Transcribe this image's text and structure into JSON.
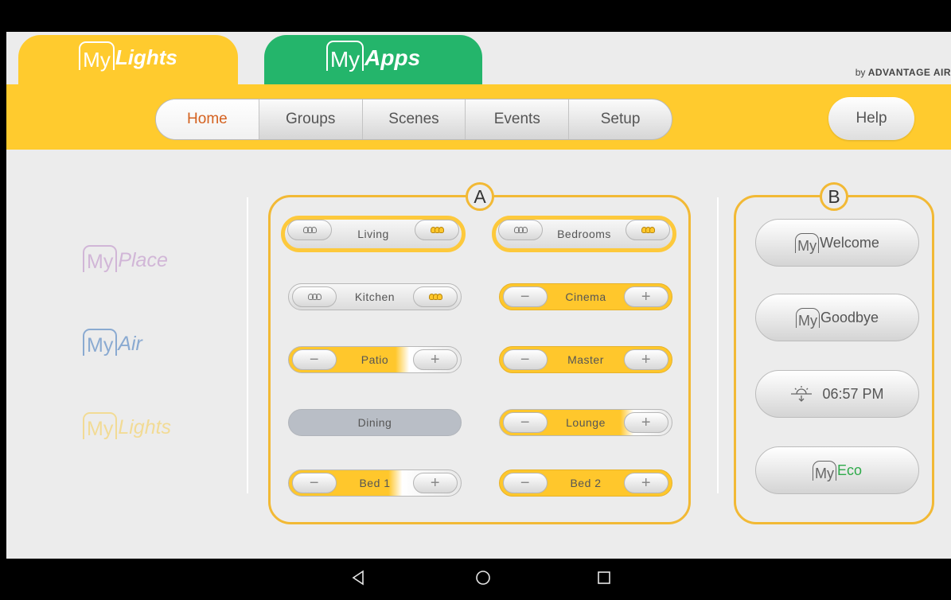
{
  "app_tabs": {
    "lights": {
      "prefix": "My",
      "name": "Lights"
    },
    "apps": {
      "prefix": "My",
      "name": "Apps"
    }
  },
  "branding": {
    "by": "by",
    "brand": "ADVANTAGE AIR"
  },
  "nav": {
    "items": [
      "Home",
      "Groups",
      "Scenes",
      "Events",
      "Setup"
    ],
    "active": "Home",
    "help": "Help"
  },
  "side_apps": [
    {
      "prefix": "My",
      "name": "Place",
      "color": "#c9a5d1"
    },
    {
      "prefix": "My",
      "name": "Air",
      "color": "#6a94c9"
    },
    {
      "prefix": "My",
      "name": "Lights",
      "color": "#f5d678"
    }
  ],
  "panel_a": {
    "label": "A",
    "zones": [
      {
        "name": "Living",
        "type": "onoff",
        "on": true
      },
      {
        "name": "Bedrooms",
        "type": "onoff",
        "on": true
      },
      {
        "name": "Kitchen",
        "type": "onoff",
        "on": false
      },
      {
        "name": "Cinema",
        "type": "dimmer",
        "level": 1.0
      },
      {
        "name": "Patio",
        "type": "dimmer",
        "level": 0.65
      },
      {
        "name": "Master",
        "type": "dimmer",
        "level": 1.0
      },
      {
        "name": "Dining",
        "type": "off"
      },
      {
        "name": "Lounge",
        "type": "dimmer",
        "level": 0.75
      },
      {
        "name": "Bed 1",
        "type": "dimmer",
        "level": 0.6
      },
      {
        "name": "Bed 2",
        "type": "dimmer",
        "level": 1.0
      }
    ],
    "minus": "−",
    "plus": "+"
  },
  "panel_b": {
    "label": "B",
    "buttons": [
      {
        "prefix": "My",
        "label": "Welcome"
      },
      {
        "prefix": "My",
        "label": "Goodbye"
      },
      {
        "icon": "sunset-icon",
        "label": "06:57 PM"
      },
      {
        "prefix": "My",
        "label": "Eco"
      }
    ]
  },
  "colors": {
    "yellow": "#ffcb2e",
    "green": "#24b56b",
    "active_nav": "#d4611f",
    "eco": "#2eaa4a"
  },
  "system_bar": {
    "icons": [
      "back-icon",
      "home-icon",
      "recents-icon"
    ]
  }
}
